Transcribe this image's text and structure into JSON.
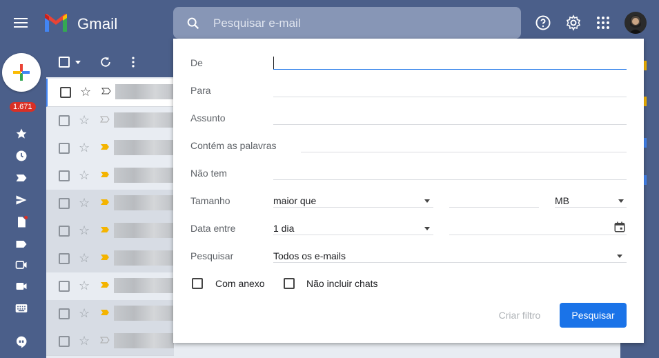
{
  "app": {
    "title": "Gmail"
  },
  "search": {
    "placeholder": "Pesquisar e-mail"
  },
  "nav": {
    "unread_badge": "1.671"
  },
  "advanced_search": {
    "from_label": "De",
    "to_label": "Para",
    "subject_label": "Assunto",
    "has_words_label": "Contém as palavras",
    "doesnt_have_label": "Não tem",
    "size_label": "Tamanho",
    "size_operator": "maior que",
    "size_unit": "MB",
    "date_within_label": "Data entre",
    "date_within_value": "1 dia",
    "search_in_label": "Pesquisar",
    "search_in_value": "Todos os e-mails",
    "has_attachment_label": "Com anexo",
    "exclude_chats_label": "Não incluir chats",
    "create_filter_label": "Criar filtro",
    "search_button_label": "Pesquisar"
  },
  "colors": {
    "accent": "#1a73e8",
    "topbar": "#4b5f8a",
    "badge": "#d93025"
  }
}
